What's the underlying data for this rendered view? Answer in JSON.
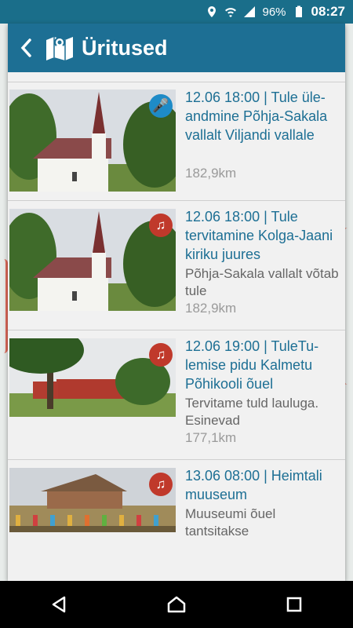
{
  "status_bar": {
    "battery": "96%",
    "time": "08:27"
  },
  "toolbar": {
    "title": "Üritused",
    "back_icon": "chevron-left-icon",
    "map_icon": "map-icon"
  },
  "events": [
    {
      "title": "12.06 18:00 | Tule üle-andmine Põhja-Sakala vallalt Viljandi vallale",
      "description": "",
      "distance": "182,9km",
      "badge": "microphone-icon",
      "badge_color": "#1e8bc7",
      "image": "church"
    },
    {
      "title": "12.06 18:00 | Tule tervitamine Kolga-Jaani kiriku juures",
      "description": "Põhja-Sakala vallalt võtab tule",
      "distance": "182,9km",
      "badge": "music-icon",
      "badge_color": "#c0392b",
      "image": "church"
    },
    {
      "title": "12.06 19:00 | TuleTu-lemise pidu Kalmetu Põhikooli õuel",
      "description": "Tervitame tuld lauluga. Esinevad",
      "distance": "177,1km",
      "badge": "music-icon",
      "badge_color": "#c0392b",
      "image": "school"
    },
    {
      "title": "13.06 08:00 | Heimtali muuseum",
      "description": "Muuseumi õuel tantsitakse",
      "distance": "",
      "badge": "music-icon",
      "badge_color": "#c0392b",
      "image": "museum"
    }
  ],
  "nav": {
    "back": "nav-back-icon",
    "home": "nav-home-icon",
    "recents": "nav-recents-icon"
  }
}
